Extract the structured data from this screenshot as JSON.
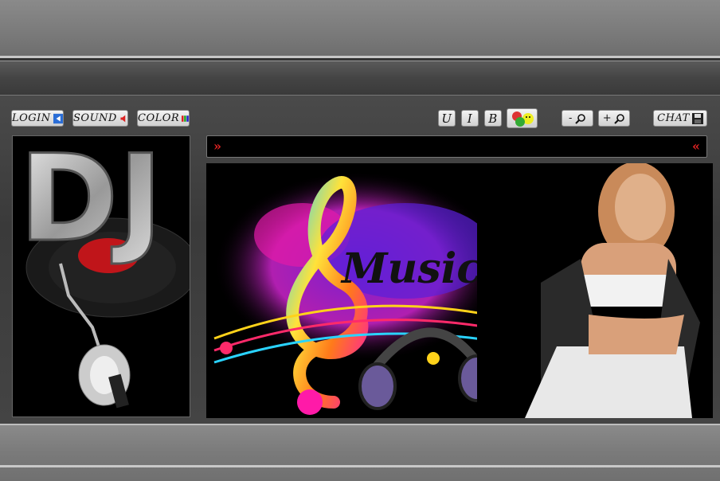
{
  "toolbar": {
    "login_label": "LOGIN",
    "sound_label": "SOUND",
    "color_label": "COLOR",
    "underline_label": "U",
    "italic_label": "I",
    "bold_label": "B",
    "zoom_out_label": "-",
    "zoom_in_label": "+",
    "chat_label": "CHAT"
  },
  "marquee": {
    "left_arrow": "»",
    "right_arrow": "«"
  },
  "banner": {
    "dj_logo_text": "DJ",
    "music_text": "Music"
  },
  "icons": {
    "login": "arrow-left-icon",
    "sound": "speaker-icon",
    "color": "palette-icon",
    "smileys": "emoticons-icon",
    "zoom": "magnifier-icon",
    "chat": "floppy-disk-icon",
    "disc": "cd-disc-icon"
  },
  "colors": {
    "accent_red": "#dd2222",
    "band_gray": "#7a7a7a"
  }
}
